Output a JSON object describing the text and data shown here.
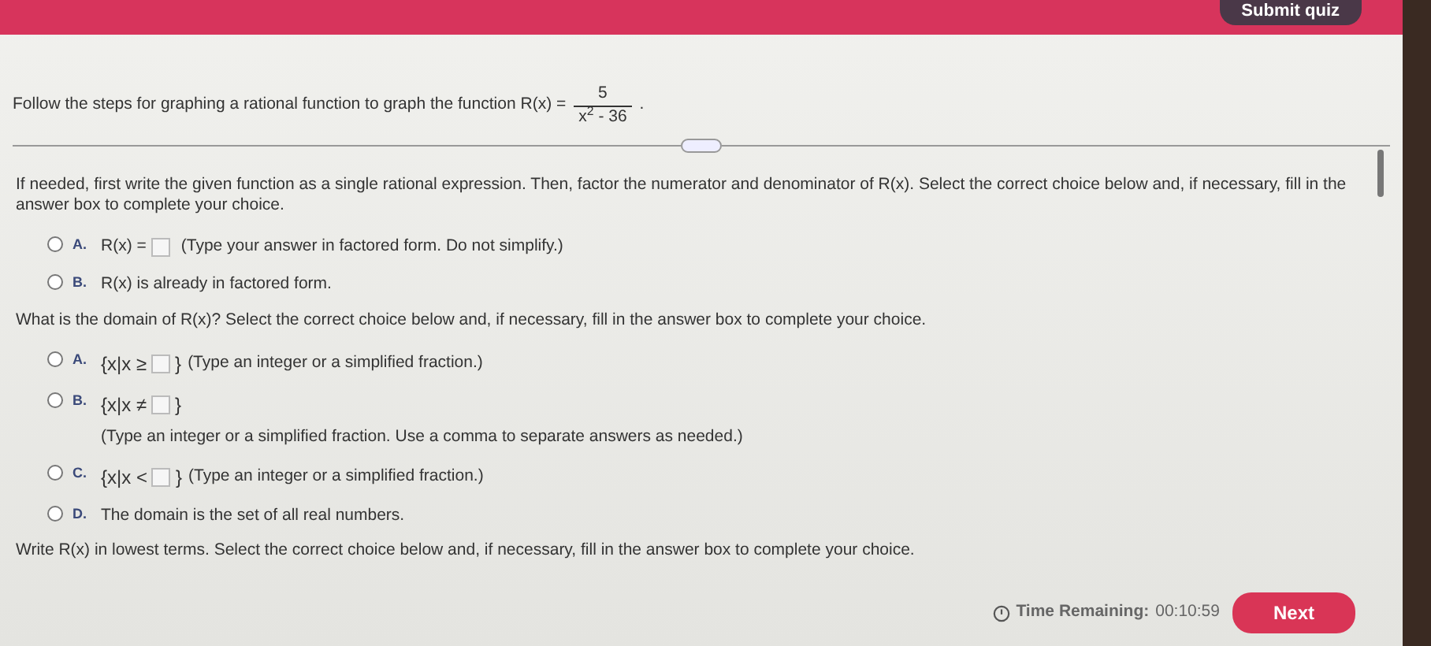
{
  "header": {
    "submit_button": "Submit quiz"
  },
  "prompt": {
    "text": "Follow the steps for graphing a rational function to graph the function",
    "function_name": "R(x) =",
    "numerator": "5",
    "denominator": "x$^{2}$ - 36",
    "end": "."
  },
  "parts": [
    {
      "question": "If needed, first write the given function as a single rational expression. Then, factor the numerator and denominator of R(x). Select the correct choice below and, if necessary, fill in the answer box to complete your choice.",
      "choices": [
        {
          "letter": "A.",
          "kind": "fill",
          "selected": false,
          "prefix": "R(x) =",
          "hint": "(Type your answer in factored form. Do not simplify.)"
        },
        {
          "letter": "B.",
          "kind": "plain",
          "selected": false,
          "text": "R(x) is already in factored form."
        }
      ]
    },
    {
      "question": "What is the domain of R(x)? Select the correct choice below and, if necessary, fill in the answer box to complete your choice.",
      "choices": [
        {
          "letter": "A.",
          "kind": "set",
          "selected": false,
          "prefix": "{x|x ≥",
          "suffix": "}",
          "hint": "(Type an integer or a simplified fraction.)"
        },
        {
          "letter": "B.",
          "kind": "set_below",
          "selected": false,
          "prefix": "{x|x ≠",
          "suffix": "}",
          "hint": "(Type an integer or a simplified fraction. Use a comma to separate answers as needed.)"
        },
        {
          "letter": "C.",
          "kind": "set",
          "selected": false,
          "prefix": "{x|x <",
          "suffix": "}",
          "hint": "(Type an integer or a simplified fraction.)"
        },
        {
          "letter": "D.",
          "kind": "plain",
          "selected": false,
          "text": "The domain is the set of all real numbers."
        }
      ]
    },
    {
      "question": "Write R(x) in lowest terms. Select the correct choice below and, if necessary, fill in the answer box to complete your choice."
    }
  ],
  "footer": {
    "timer_label": "Time Remaining:",
    "timer_value": "00:10:59",
    "next_button": "Next"
  }
}
